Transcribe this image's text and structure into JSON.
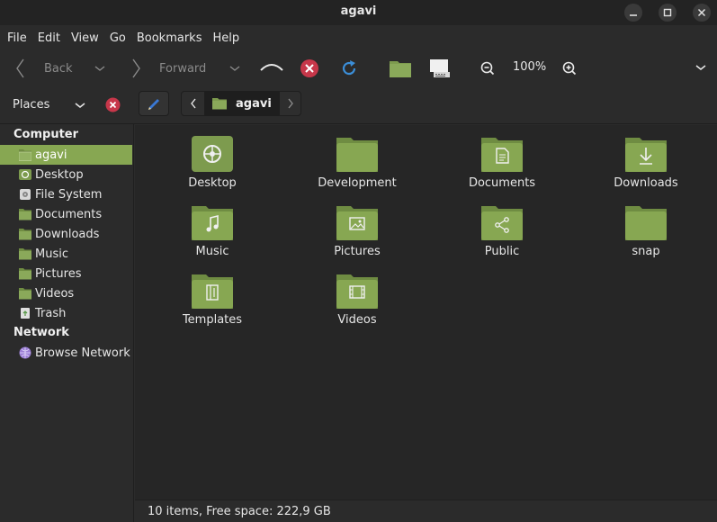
{
  "window": {
    "title": "agavi"
  },
  "menubar": [
    "File",
    "Edit",
    "View",
    "Go",
    "Bookmarks",
    "Help"
  ],
  "toolbar": {
    "back_label": "Back",
    "forward_label": "Forward",
    "zoom": "100%"
  },
  "places": {
    "label": "Places"
  },
  "location": {
    "current": "agavi"
  },
  "sidebar": {
    "computer_heading": "Computer",
    "network_heading": "Network",
    "items": [
      {
        "label": "agavi",
        "icon": "folder-icon"
      },
      {
        "label": "Desktop",
        "icon": "desktop-icon"
      },
      {
        "label": "File System",
        "icon": "drive-icon"
      },
      {
        "label": "Documents",
        "icon": "folder-icon"
      },
      {
        "label": "Downloads",
        "icon": "folder-icon"
      },
      {
        "label": "Music",
        "icon": "folder-icon"
      },
      {
        "label": "Pictures",
        "icon": "folder-icon"
      },
      {
        "label": "Videos",
        "icon": "folder-icon"
      },
      {
        "label": "Trash",
        "icon": "trash-icon"
      }
    ],
    "network_items": [
      {
        "label": "Browse Network",
        "icon": "network-icon"
      }
    ]
  },
  "files": [
    {
      "label": "Desktop",
      "emblem": "desktop"
    },
    {
      "label": "Development",
      "emblem": "none"
    },
    {
      "label": "Documents",
      "emblem": "document"
    },
    {
      "label": "Downloads",
      "emblem": "download"
    },
    {
      "label": "Music",
      "emblem": "music"
    },
    {
      "label": "Pictures",
      "emblem": "picture"
    },
    {
      "label": "Public",
      "emblem": "share"
    },
    {
      "label": "snap",
      "emblem": "none"
    },
    {
      "label": "Templates",
      "emblem": "template"
    },
    {
      "label": "Videos",
      "emblem": "video"
    }
  ],
  "status": {
    "text": "10 items, Free space: 222,9 GB"
  },
  "colors": {
    "accent": "#87a752",
    "folder": "#7d9b4e",
    "background": "#262626"
  }
}
